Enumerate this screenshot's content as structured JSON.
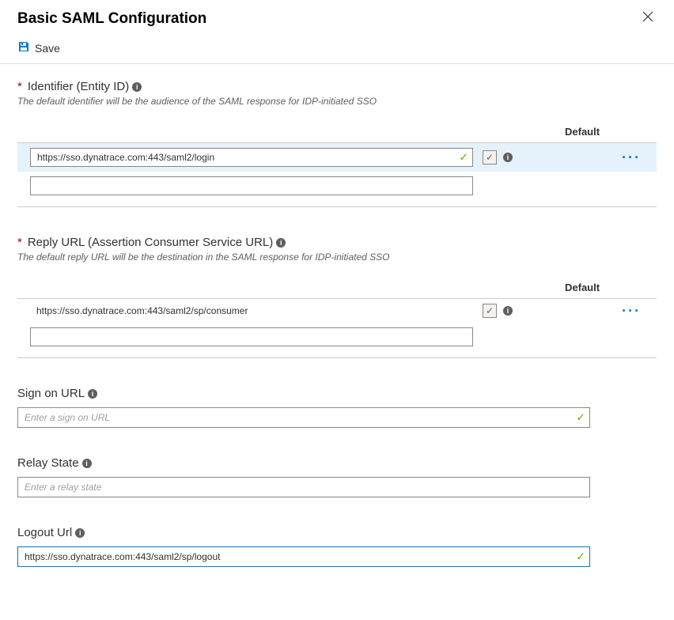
{
  "header": {
    "title": "Basic SAML Configuration"
  },
  "toolbar": {
    "save_label": "Save"
  },
  "sections": {
    "identifier": {
      "label": "Identifier (Entity ID)",
      "help": "The default identifier will be the audience of the SAML response for IDP-initiated SSO",
      "default_header": "Default",
      "rows": [
        {
          "value": "https://sso.dynatrace.com:443/saml2/login",
          "validated": true,
          "default_checked": true,
          "has_info": true,
          "has_more": true
        },
        {
          "value": "",
          "validated": false,
          "default_checked": false,
          "has_info": false,
          "has_more": false
        }
      ]
    },
    "reply_url": {
      "label": "Reply URL (Assertion Consumer Service URL)",
      "help": "The default reply URL will be the destination in the SAML response for IDP-initiated SSO",
      "default_header": "Default",
      "rows": [
        {
          "value": "https://sso.dynatrace.com:443/saml2/sp/consumer",
          "validated": false,
          "default_checked": true,
          "has_info": true,
          "has_more": true,
          "static": true
        },
        {
          "value": "",
          "validated": false,
          "default_checked": false,
          "has_info": false,
          "has_more": false
        }
      ]
    },
    "sign_on": {
      "label": "Sign on URL",
      "placeholder": "Enter a sign on URL",
      "value": "",
      "validated": true
    },
    "relay_state": {
      "label": "Relay State",
      "placeholder": "Enter a relay state",
      "value": "",
      "validated": false
    },
    "logout": {
      "label": "Logout Url",
      "placeholder": "",
      "value": "https://sso.dynatrace.com:443/saml2/sp/logout",
      "validated": true,
      "focused": true
    }
  }
}
